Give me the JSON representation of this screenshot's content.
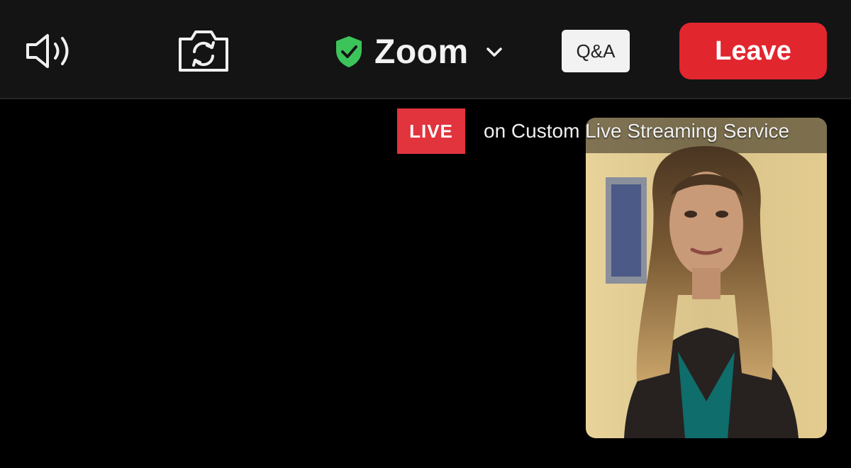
{
  "toolbar": {
    "speaker_icon": "speaker-icon",
    "camera_switch_icon": "camera-switch-icon",
    "meeting_title": "Zoom",
    "security_icon": "shield-check-icon",
    "dropdown_icon": "chevron-down-icon",
    "qa_label": "Q&A",
    "leave_label": "Leave"
  },
  "live": {
    "badge_label": "LIVE",
    "status_text": "on Custom Live Streaming Service"
  },
  "video": {
    "self_view_icon": "participant-video-tile"
  },
  "colors": {
    "topbar": "#141414",
    "background": "#000000",
    "leave_button": "#e2262e",
    "live_badge": "#e2343d",
    "shield": "#3cc45a",
    "qa_button": "#f2f2f2"
  }
}
